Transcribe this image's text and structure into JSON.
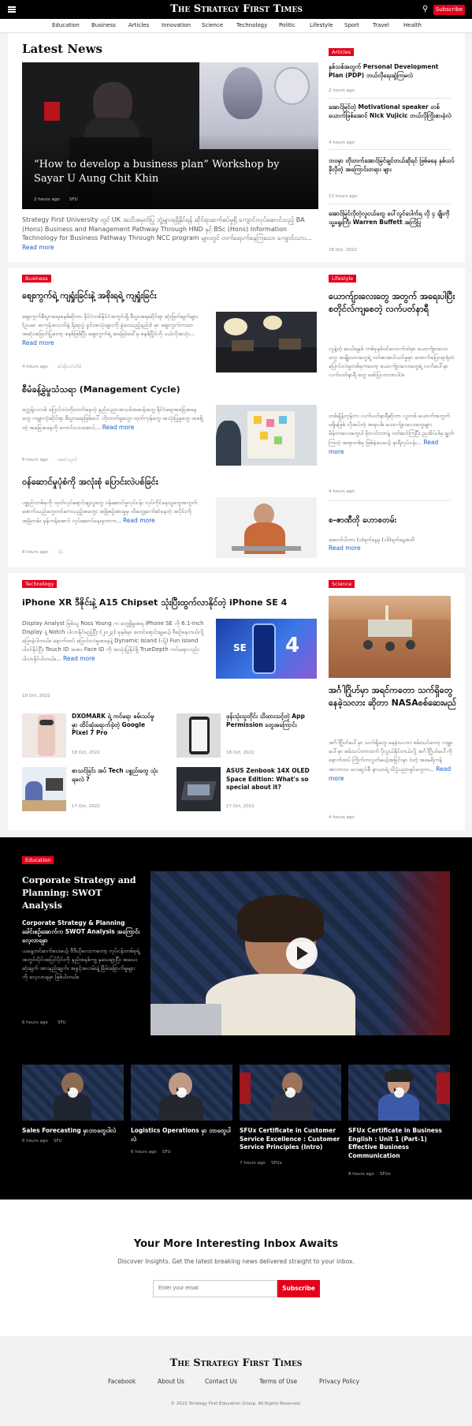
{
  "brand": {
    "logo_text": "The Strategy First Times",
    "subscribe_label": "Subscribe"
  },
  "nav": [
    "Education",
    "Business",
    "Articles",
    "Innovation",
    "Science",
    "Technology",
    "Politic",
    "Lifestyle",
    "Sport",
    "Travel",
    "Health"
  ],
  "latest": {
    "heading": "Latest News",
    "hero_title": "“How to develop a business plan” Workshop by Sayar U Aung Chit Khin",
    "hero_time": "2 hours ago",
    "hero_author": "SFU",
    "summary": "Strategy First University တွင် UK အသိအမှတ်ပြု ဘွဲ့များရရှိနိုင်ရန် ဆိုင်ရာဆက်စပ်မှုရှိ ကျောင်းလုပ်ဆောင်သည့် BA (Hons) Business and Management Pathway Through HND နှင့် BSc (Hons) Information Technology for Business Pathway Through NCC program များတွင် တက်ရောက်နေကြသော ကျောင်းသား...",
    "read_more": "Read more"
  },
  "articles_side": {
    "badge": "Articles",
    "items": [
      {
        "title": "နှစ်သစ်အတွက် Personal Development Plan (PDP) ဘယ်လိုရေးဆွဲကြမလဲ",
        "time": "2 hours ago"
      },
      {
        "title": "အောင်မြင်တဲ့ Motivational speaker တစ်ယောက်ဖြစ်အောင် Nick Vujicic ဘယ်လိုကြိုးစားခဲ့လဲ",
        "time": "4 hours ago"
      },
      {
        "title": "ဘဝမှာ တိုးတက်အောင်မြင်ချင်တယ်ဆိုရင် ဖြစ်မနေ နှစ်ယပ်ခိုလိုတဲ့ အကြောင်းတရား များ",
        "time": "12 hours ago"
      },
      {
        "title": "အောင်မြင်လိုတဲ့လူငယ်တွေ ပေါ်လွင်ပေါက်ရ လို ၄ ချိုးကို သူ့ရွေးကြီး Warren Buffett အကြံပြု",
        "time": "18 Oct, 2022"
      }
    ]
  },
  "business": {
    "badge": "Business",
    "items": [
      {
        "title": "စျေးကွက်ရဲ့ ကျရှုံးခြင်းနဲ့ အစိုးရရဲ့ ကျရှုံးခြင်း",
        "summary": "စျေးကွက်စီးပွားရေးစနစ်ဆိုတာ နိုင်ငံတစ်နိုင်ငံအတွင်းရှိ စီးပွားရေးဆိုင်ရာ ဆုံးဖြတ်ချက်များ (ဥပမာ အကုန်အသတ်နဲ့ ရိုးရာပွဲ ခွင်းအသုံးများကို ခွဲဝေသည့်နည်း) မှာ စျေးကွက်ကသာ အဆုံးအဖြတ်ပြုတော့ စနစ်ဖြစ်ပြီး စျေးကွက်ရဲ့ အခြေခံဒေါ်မှ စနစ်ပြိုင်ကို ပယ်လိုအသုံး...",
        "time": "4 hours ago",
        "author": "ဇင်းမိုးလင်းတိမ်"
      },
      {
        "title": "စီမံခန့်ခွဲမှုသံသရာ (Management Cycle)",
        "summary": "စက္ကန့်လလစ် ပြောင်းလဲတိုးတက်နေတဲ့ နည်းပညာအသစ်အဆန်းတွေ နိုင်ငံရေးအခြေအနေတွေ ကမ္ဘာလုံးဆိုင်ရာ စီးပွားရေးဖြစ်ပေါ် တိုးတက်မှုတွေ၊ ထုတ်ကုန်တွေ အသုံးပြုမှုတွေ အစရှိတဲ့ အခြေအနေကို ကောင်းလာအောင်...",
        "time": "6 hours ago",
        "author": "ဇေမင်းဟွတ်"
      },
      {
        "title": "ဝန်ဆောင်မှုပုံစံကို အလုံးစုံ ပြောင်းလဲပစ်ခြင်း",
        "summary": "ပစ္စည်းတစ်ခုကို ထုတ်လုပ်ရောင်းချသူတွေ ဝန်ဆောင်မှုလုပ်ငန်း လုပ်ကိုင်နေသူတွေအတွက် ဖောက်သည်တွေတင်မကသည့်အတွေး အမြဲစဉ်းစားမှုမှ ထိတွေ့ဆက်ဆံနေတဲ့ အပိုင်းကို အမြဲတမ်း မှန်ကန်အောင် လုပ်ဆောင်နေရတာက...",
        "time": "8 hours ago",
        "author": "သိုး"
      }
    ]
  },
  "lifestyle": {
    "badge": "Lifestyle",
    "title": "ယောက်ျားလေးတွေ အတွက် အရေးပါပြီး စတိုင်လ်ကျစေတဲ့ လက်ပတ်နာရီ",
    "p1": "လူနဲ့တဲ့ ဆယ်ရနှစ် တစ်ခုနှစ်ဝင်လောက်ထဲမှာ ယောက်ျားလေးတွေ အမျိုးသားတွေရဲ့ ဝတ်စားဆင်ယင်မှုမှာ ထောက်ပြောရာရုံထဲ ပြောင်းလဲမှုတစ်ခုကတော့ ယောက်ျားလေးတွေရဲ့ လက်ပေါ်မှာ လက်ပတ်နာရီ တွေ ဖော်ပြလာတာပါပဲ။",
    "p2": "တစ်ချိန်တုန်းက လက်ပတ်နာရီဆိုတာ လူတစ် ယောက်အတွက် မရှိမဖြစ် လိုအပ်တဲ့ အရာပါ။ ယောက်ျားလေးတွေများ မိန်းကလေးတွေပါ မိုးလင်းတာနဲ့ ဝတ်ဆင်ကြပြီး ညအိပ်ပါမှ ချွတ်ကြတဲ့ အရာတစ်ခု ဖြစ်ခဲ့ပေမယ့် နာရီလုပ်ငန်း...",
    "time": "4 hours ago",
    "title2": "စ-ဇာဏီတို ဟောစတမ်း",
    "summary2": "အောက်ပါဘား (၁)ရက်နေ့မှ (၁၆)ရက်နေ့အထိ"
  },
  "tech": {
    "badge": "Technology",
    "title": "iPhone XR ဒီဇိုင်းနဲ့ A15 Chipset သုံးပြီးထွက်လာနိုင်တဲ့ iPhone SE 4",
    "summary": "Display Analyst ဖြစ်သူ Ross Young က တွေ့ရှိမှုအရ iPhone SE ကို 6.1-inch Display နဲ့ Notch ပါလာနိုင်မည့်ပြီး (၂၀၂၃) ခုနှစ်မှာ စတင်ရောင်းချမယ့် စီစဉ်နေတယ်လို့ ပြောခဲ့ပါတယ်။ နောက်ထပ် ပြောင်းလဲမှုအနေနဲ့ Dynamic Island (သို့) Fun Island ပါဝင်နိုင်ပြီး Touch ID အစား Face ID ကို အသုံးပြုနိုင်ဖို့ TrueDepth ကင်မရာလည်း ပါလာနိုင်ပါတယ်။...",
    "date": "18 Oct, 2022",
    "small": [
      {
        "title": "DXOMARK ရဲ့ ကင်မရာ စမ်းသပ်မှုမှာ ထိပ်ဆုံးရောက်ခဲ့တဲ့ Google Pixel 7 Pro",
        "date": "18 Oct, 2022"
      },
      {
        "title": "ဖုန်းသုံးသူတိုင်း သိထားသင့်တဲ့ App Permission တွေအကြောင်း",
        "date": "18 Oct, 2022"
      },
      {
        "title": "စာသင်ခြင်း အပ် Tech ပစ္စည်းတွေ သုံးရမလဲ ?",
        "date": "17 Oct, 2022"
      },
      {
        "title": "ASUS Zenbook 14X OLED Space Edition: What's so special about it?",
        "date": "17 Oct, 2022"
      }
    ]
  },
  "science": {
    "badge": "Science",
    "title": "အင်္ဂါဂြိုဟ်မှာ အရင်ကတော သက်ရှိတွေ နေခဲ့သလား ဆိုတာ NASAစစ်ဆေးမည်",
    "summary": "အင်္ဂါဂြိုဟ်ပေါ်မှာ သက်ရှိတွေ နေခဲ့သလား စမ်းသပ်တော့ ကမ္ဘာပေါ်မှာ စမ်းသပ်တာထက် ပိုလွယ်နိုင်တယ်လို့ အင်္ဂါဂြိုဟ်ပေါ်ကို နောက်ထပ် ကြိုက်တလွတ်မယ့်အခြင်းမှာ ဝဲတဲ့ အမေရိကန် အာကာသ လေဆွင်စီ နာသာရဲ့ သိပ္ပံပညာရှင်တွေက...",
    "time": "4 hours ago"
  },
  "education": {
    "badge": "Education",
    "title": "Corporate Strategy and Planning: SWOT Analysis",
    "bold": "Corporate Strategy & Planning ခေါင်းစဉ်အောက်က SWOT Analysis အကြောင်း လေ့လာရမှာ",
    "summary": "ယနေ့တင်ဆက်ပေးမယ့် ဗီဒီယိုလေးကတော့ လုပ်ငန်းတစ်ခုရဲ့ အတွင်းပိုင်းအပြင်ပိုင်းကို နည်းစနစ်ကျ နှသေချာပြီး အသေးဆုံးချက် အားနည်းချက်၊ အခွင့်အလမ်းနဲ့ ခြိမ်းခြောက်မှုများကို လေ့လာရမှာ ဖြစ်ပါတယ်။",
    "time": "6 hours ago",
    "author": "SFU",
    "videos": [
      {
        "title": "Sales Forecasting မှာဘာတွေပါလဲ",
        "time": "6 hours ago",
        "author": "SFU"
      },
      {
        "title": "Logistics Operations မှာ ဘာတွေပါလဲ",
        "time": "6 hours ago",
        "author": "SFU"
      },
      {
        "title": "SFUx Certificate in Customer Service Excellence : Customer Service Principles (Intro)",
        "time": "7 hours ago",
        "author": "SFUx"
      },
      {
        "title": "SFUx Certificate in Business English : Unit 1 (Part-1) Effective Business Communication",
        "time": "8 hours ago",
        "author": "SFUx"
      }
    ]
  },
  "newsletter": {
    "title": "Your More Interesting Inbox Awaits",
    "subtitle": "Discover Insights. Get the latest breaking news delivered straight to your inbox.",
    "placeholder": "Enter your email",
    "button": "Subscribe"
  },
  "footer": {
    "logo_text": "The Strategy First Times",
    "links": [
      "Facebook",
      "About Us",
      "Contact Us",
      "Terms of Use",
      "Privacy Policy"
    ],
    "copyright": "© 2022 Strategy First Education Group. All Rights Reserved."
  },
  "colors": {
    "brand_red": "#e4001b",
    "link_blue": "#1a5fc7"
  }
}
